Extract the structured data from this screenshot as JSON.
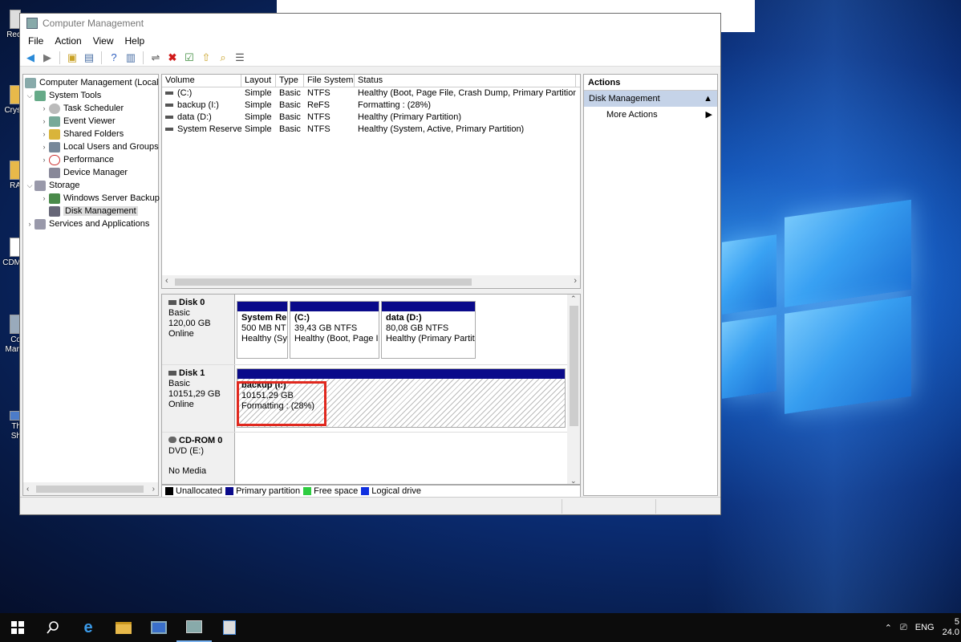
{
  "window": {
    "title": "Computer Management"
  },
  "menu": [
    "File",
    "Action",
    "View",
    "Help"
  ],
  "tree": {
    "root": "Computer Management (Local",
    "system_tools": "System Tools",
    "task_scheduler": "Task Scheduler",
    "event_viewer": "Event Viewer",
    "shared_folders": "Shared Folders",
    "local_users": "Local Users and Groups",
    "performance": "Performance",
    "device_manager": "Device Manager",
    "storage": "Storage",
    "wsb": "Windows Server Backup",
    "disk_management": "Disk Management",
    "services": "Services and Applications"
  },
  "volumes": {
    "headers": [
      "Volume",
      "Layout",
      "Type",
      "File System",
      "Status"
    ],
    "rows": [
      [
        "(C:)",
        "Simple",
        "Basic",
        "NTFS",
        "Healthy (Boot, Page File, Crash Dump, Primary Partition)"
      ],
      [
        "backup (I:)",
        "Simple",
        "Basic",
        "ReFS",
        "Formatting : (28%)"
      ],
      [
        "data (D:)",
        "Simple",
        "Basic",
        "NTFS",
        "Healthy (Primary Partition)"
      ],
      [
        "System Reserved",
        "Simple",
        "Basic",
        "NTFS",
        "Healthy (System, Active, Primary Partition)"
      ]
    ]
  },
  "disks": {
    "disk0": {
      "name": "Disk 0",
      "type": "Basic",
      "size": "120,00 GB",
      "state": "Online",
      "p1": {
        "name": "System Re",
        "size": "500 MB NT",
        "status": "Healthy (Sy"
      },
      "p2": {
        "name": " (C:)",
        "size": "39,43 GB NTFS",
        "status": "Healthy (Boot, Page I"
      },
      "p3": {
        "name": "data  (D:)",
        "size": "80,08 GB NTFS",
        "status": "Healthy (Primary Partit"
      }
    },
    "disk1": {
      "name": "Disk 1",
      "type": "Basic",
      "size": "10151,29 GB",
      "state": "Online",
      "p1": {
        "name": "backup  (I:)",
        "size": "10151,29 GB",
        "status": "Formatting : (28%)"
      }
    },
    "cdrom": {
      "name": "CD-ROM 0",
      "type": "DVD (E:)",
      "state": "No Media"
    }
  },
  "legend": {
    "unallocated": "Unallocated",
    "primary": "Primary partition",
    "free": "Free space",
    "logical": "Logical drive"
  },
  "actions": {
    "title": "Actions",
    "section": "Disk Management",
    "more": "More Actions"
  },
  "desktop_icons": [
    "Rec",
    "Crys",
    "RA",
    "CDM",
    "Co",
    "Man",
    "Th",
    "Sh"
  ],
  "tray": {
    "lang": "ENG",
    "time": "5",
    "date": "24.0"
  },
  "colors": {
    "primary_partition": "#0a0a8a",
    "free_space": "#2ecc40",
    "logical_drive": "#1030e0",
    "highlight": "#e0281e",
    "accent": "#c5d3e8"
  }
}
